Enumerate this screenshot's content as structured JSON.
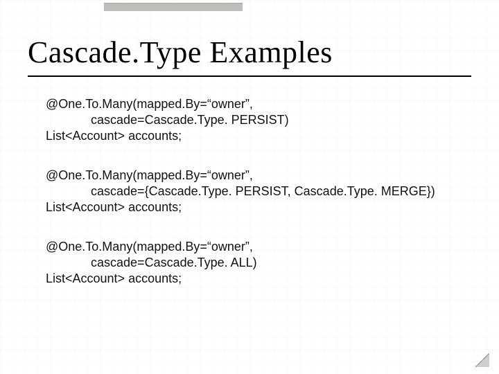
{
  "title": "Cascade.Type Examples",
  "examples": [
    {
      "line1": "@One.To.Many(mapped.By=“owner”,",
      "line2": "             cascade=Cascade.Type. PERSIST)",
      "line3": "List<Account> accounts;"
    },
    {
      "line1": "@One.To.Many(mapped.By=“owner”,",
      "line2": "             cascade={Cascade.Type. PERSIST, Cascade.Type. MERGE})",
      "line3": "List<Account> accounts;"
    },
    {
      "line1": "@One.To.Many(mapped.By=“owner”,",
      "line2": "             cascade=Cascade.Type. ALL)",
      "line3": "List<Account> accounts;"
    }
  ]
}
